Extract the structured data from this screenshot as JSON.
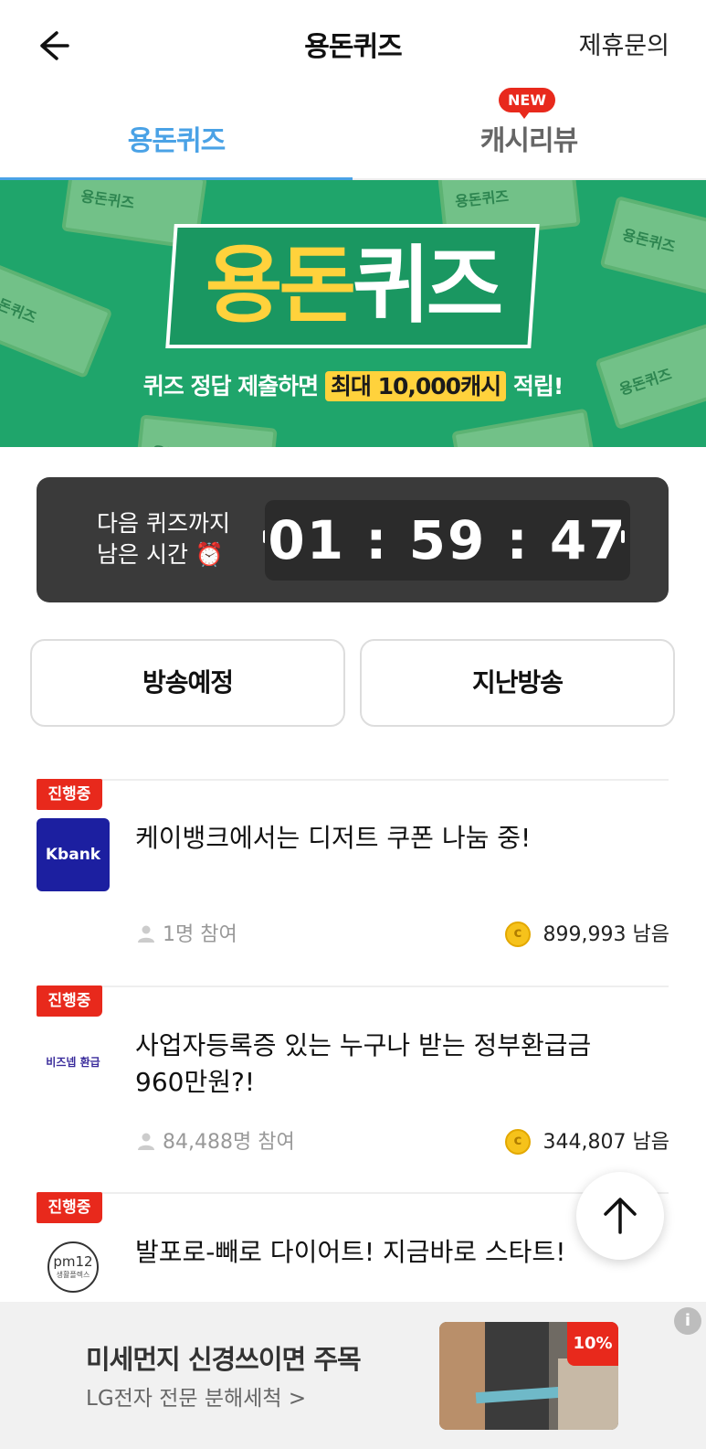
{
  "header": {
    "title": "용돈퀴즈",
    "partner_link": "제휴문의"
  },
  "tabs": [
    {
      "label": "용돈퀴즈",
      "active": true
    },
    {
      "label": "캐시리뷰",
      "active": false,
      "badge": "NEW"
    }
  ],
  "banner": {
    "bill_text": "용돈퀴즈",
    "logo_part1": "용돈",
    "logo_part2": "퀴즈",
    "sub_prefix": "퀴즈 정답 제출하면",
    "sub_highlight": "최대 10,000캐시",
    "sub_suffix": "적립!"
  },
  "timer": {
    "label_line1": "다음 퀴즈까지",
    "label_line2": "남은 시간 ⏰",
    "time": "01 : 59 : 47"
  },
  "segments": {
    "upcoming": "방송예정",
    "past": "지난방송"
  },
  "quizzes": [
    {
      "status": "진행중",
      "logo": "Kbank",
      "title": "케이뱅크에서는 디저트 쿠폰 나눔 중!",
      "participants": "1명 참여",
      "remaining": "899,993 남음"
    },
    {
      "status": "진행중",
      "logo": "비즈넵 환급",
      "title": "사업자등록증 있는 누구나 받는 정부환급금 960만원?!",
      "participants": "84,488명 참여",
      "remaining": "344,807 남음"
    },
    {
      "status": "진행중",
      "logo": "pm12",
      "logo_sub": "생활플렉스",
      "title": "발포로-빼로 다이어트! 지금바로 스타트!"
    }
  ],
  "ad": {
    "title": "미세먼지 신경쓰이면 주목",
    "subtitle": "LG전자 전문 분해세척 >",
    "badge": "10%",
    "info": "i"
  },
  "colors": {
    "accent": "#4aa2e6",
    "status_red": "#e8291c",
    "banner_green": "#1fa56b",
    "banner_yellow": "#ffd23c"
  }
}
